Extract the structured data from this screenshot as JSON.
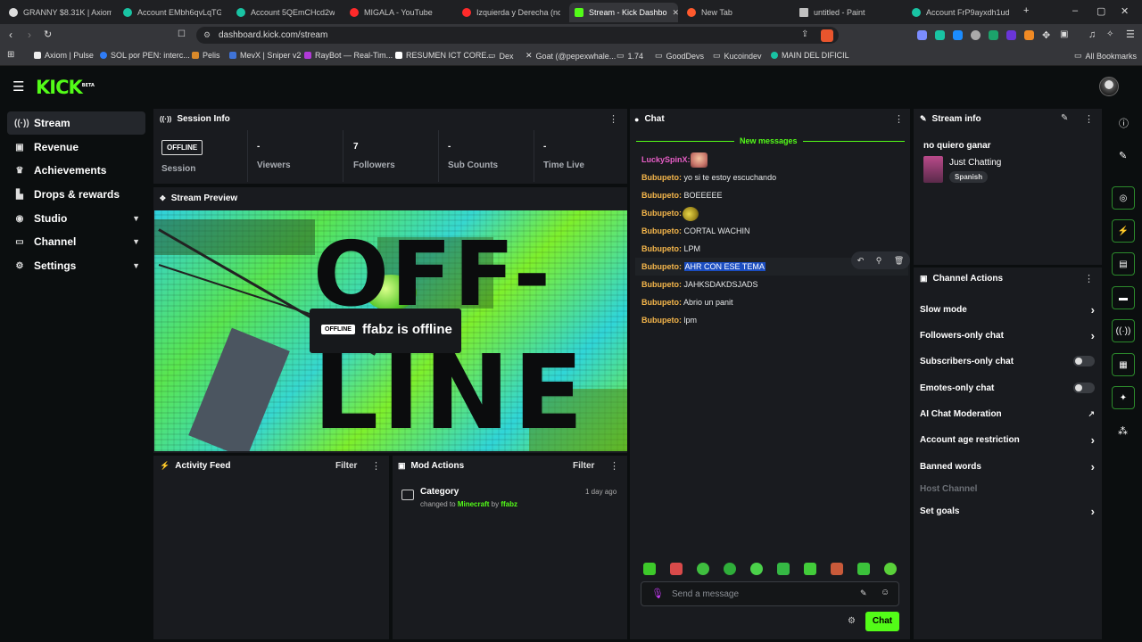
{
  "browser": {
    "tabs": [
      {
        "label": "GRANNY $8.31K | Axiom",
        "color": "#dddddd"
      },
      {
        "label": "Account EMbh6qvLqTGLg",
        "color": "#19c3a3"
      },
      {
        "label": "Account 5QEmCHcd2wi2C",
        "color": "#19c3a3"
      },
      {
        "label": "MIGALA - YouTube",
        "color": "#ff2a2a"
      },
      {
        "label": "Izquierda y Derecha (no e",
        "color": "#ff2a2a"
      },
      {
        "label": "Stream - Kick Dashbo",
        "color": "#53fc18"
      },
      {
        "label": "New Tab",
        "color": "#ff5a2d"
      },
      {
        "label": "untitled - Paint",
        "color": "#c0c0c0"
      },
      {
        "label": "Account FrP9ayxdh1udmU",
        "color": "#19c3a3"
      }
    ],
    "url": "dashboard.kick.com/stream",
    "bookmarks": [
      "Axiom | Pulse",
      "SOL por PEN: interc...",
      "Pelis",
      "MevX | Sniper v2",
      "RayBot — Real-Tim...",
      "RESUMEN ICT CORE...",
      "Dex",
      "Goat (@pepexwhale...",
      "1.74",
      "GoodDevs",
      "Kucoindev",
      "MAIN DEL DIFICIL",
      "All Bookmarks"
    ]
  },
  "app": {
    "logo": "KICK",
    "logo_badge": "BETA"
  },
  "sidebar": {
    "items": [
      {
        "label": "Stream",
        "icon": "broadcast-icon"
      },
      {
        "label": "Revenue",
        "icon": "dollar-icon"
      },
      {
        "label": "Achievements",
        "icon": "trophy-icon"
      },
      {
        "label": "Drops & rewards",
        "icon": "gift-icon"
      },
      {
        "label": "Studio",
        "icon": "studio-icon"
      },
      {
        "label": "Channel",
        "icon": "channel-icon"
      },
      {
        "label": "Settings",
        "icon": "gear-icon"
      }
    ]
  },
  "session": {
    "title": "Session Info",
    "badge": "OFFLINE",
    "session_label": "Session",
    "stats": [
      {
        "value": "-",
        "label": "Viewers"
      },
      {
        "value": "7",
        "label": "Followers"
      },
      {
        "value": "-",
        "label": "Sub Counts"
      },
      {
        "value": "-",
        "label": "Time Live"
      }
    ]
  },
  "preview": {
    "title": "Stream Preview",
    "offline_badge": "OFFLINE",
    "offline_text": "ffabz is offline",
    "big_text_1": "OFF-",
    "big_text_2": "LINE"
  },
  "activity": {
    "title": "Activity Feed",
    "filter": "Filter"
  },
  "mod": {
    "title": "Mod Actions",
    "filter": "Filter",
    "entry_title": "Category",
    "entry_time": "1 day ago",
    "entry_prefix": "changed to",
    "entry_category": "Minecraft",
    "entry_by": "by",
    "entry_user": "ffabz"
  },
  "chat": {
    "title": "Chat",
    "new_messages": "New messages",
    "messages": [
      {
        "user": "LuckySpinX:",
        "text": "",
        "emote": true,
        "user_color": "#e85ec7"
      },
      {
        "user": "Bubupeto:",
        "text": "yo si te estoy escuchando"
      },
      {
        "user": "Bubupeto:",
        "text": "BOEEEEE"
      },
      {
        "user": "Bubupeto:",
        "text": "",
        "emote": true
      },
      {
        "user": "Bubupeto:",
        "text": "CORTAL WACHIN"
      },
      {
        "user": "Bubupeto:",
        "text": "LPM"
      },
      {
        "user": "Bubupeto:",
        "text": "AHR CON ESE TEMA"
      },
      {
        "user": "Bubupeto:",
        "text": "JAHKSDAKDSJADS"
      },
      {
        "user": "Bubupeto:",
        "text": "Abrio un panit"
      },
      {
        "user": "Bubupeto:",
        "text": "lpm"
      }
    ],
    "input_placeholder": "Send a message",
    "send_label": "Chat"
  },
  "stream_info": {
    "title": "Stream info",
    "stream_title": "no quiero ganar",
    "category": "Just Chatting",
    "language": "Spanish"
  },
  "channel_actions": {
    "title": "Channel Actions",
    "items": [
      {
        "label": "Slow mode",
        "control": "arrow"
      },
      {
        "label": "Followers-only chat",
        "control": "arrow"
      },
      {
        "label": "Subscribers-only chat",
        "control": "toggle"
      },
      {
        "label": "Emotes-only chat",
        "control": "toggle"
      },
      {
        "label": "AI Chat Moderation",
        "control": "external"
      },
      {
        "label": "Account age restriction",
        "control": "arrow"
      },
      {
        "label": "Banned words",
        "control": "arrow"
      },
      {
        "label": "Host Channel",
        "control": "none"
      },
      {
        "label": "Set goals",
        "control": "arrow"
      }
    ]
  },
  "colors": {
    "accent": "#53fc18",
    "panel": "#191b1f",
    "bg": "#0b0e0f"
  }
}
